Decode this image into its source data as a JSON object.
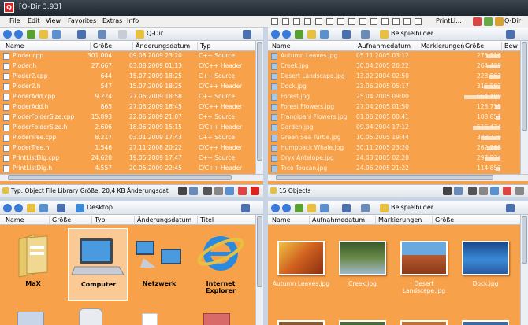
{
  "window": {
    "title": "[Q-Dir 3.93]",
    "app_icon": "Q"
  },
  "menu": [
    "File",
    "Edit",
    "View",
    "Favorites",
    "Extras",
    "Info"
  ],
  "top_right_toolbar": {
    "print_label": "PrintLi...",
    "app_label": "Q-Dir"
  },
  "pane_tl": {
    "path": "Q-Dir",
    "columns": [
      "Name",
      "Größe",
      "Änderungsdatum",
      "Typ"
    ],
    "rows": [
      [
        "Ploder.cpp",
        "301.004",
        "09.08.2009 23:20",
        "C++ Source"
      ],
      [
        "Ploder.h",
        "27.667",
        "03.08.2009 01:13",
        "C/C++ Header"
      ],
      [
        "Ploder2.cpp",
        "644",
        "15.07.2009 18:25",
        "C++ Source"
      ],
      [
        "Ploder2.h",
        "547",
        "15.07.2009 18:25",
        "C/C++ Header"
      ],
      [
        "PloderAdd.cpp",
        "9.224",
        "27.06.2009 18:58",
        "C++ Source"
      ],
      [
        "PloderAdd.h",
        "865",
        "27.06.2009 18:45",
        "C/C++ Header"
      ],
      [
        "PloderFolderSize.cpp",
        "15.893",
        "22.06.2009 21:07",
        "C++ Source"
      ],
      [
        "PloderFolderSize.h",
        "2.606",
        "18.06.2009 15:15",
        "C/C++ Header"
      ],
      [
        "PloderTree.cpp",
        "8.217",
        "03.01.2009 17:43",
        "C++ Source"
      ],
      [
        "PloderTree.h",
        "1.546",
        "27.11.2008 20:22",
        "C/C++ Header"
      ],
      [
        "PrintListDlg.cpp",
        "24.620",
        "19.05.2009 17:47",
        "C++ Source"
      ],
      [
        "PrintListDlg.h",
        "4.557",
        "20.05.2009 22:45",
        "C/C++ Header"
      ]
    ],
    "status": "Typ: Object File Library Größe: 20,4 KB Änderungsdat"
  },
  "pane_tr": {
    "path": "Beispielbilder",
    "columns": [
      "Name",
      "Aufnahmedatum",
      "Markierungen",
      "Größe",
      "Bew"
    ],
    "rows": [
      [
        "Autumn Leaves.jpg",
        "05.11.2005 03:12",
        "",
        "276.216"
      ],
      [
        "Creek.jpg",
        "30.04.2005 20:22",
        "",
        "264.409"
      ],
      [
        "Desert Landscape.jpg",
        "13.02.2004 02:50",
        "",
        "228.863"
      ],
      [
        "Dock.jpg",
        "23.06.2005 05:17",
        "",
        "316.892"
      ],
      [
        "Forest.jpg",
        "25.04.2005 09:00",
        "",
        "664.489"
      ],
      [
        "Forest Flowers.jpg",
        "27.04.2005 01:50",
        "",
        "128.755"
      ],
      [
        "Frangipani Flowers.jpg",
        "01.06.2005 00:41",
        "",
        "108.851"
      ],
      [
        "Garden.jpg",
        "09.04.2004 17:12",
        "",
        "516.424"
      ],
      [
        "Green Sea Turtle.jpg",
        "10.05.2005 19:44",
        "",
        "378.729"
      ],
      [
        "Humpback Whale.jpg",
        "30.11.2005 23:20",
        "",
        "262.268"
      ],
      [
        "Oryx Antelope.jpg",
        "24.03.2005 02:20",
        "",
        "297.834"
      ],
      [
        "Toco Toucan.jpg",
        "24.06.2005 21:22",
        "",
        "114.857"
      ]
    ],
    "size_fraction": [
      0.42,
      0.4,
      0.34,
      0.48,
      1.0,
      0.19,
      0.16,
      0.78,
      0.57,
      0.39,
      0.45,
      0.17
    ],
    "status": "15 Objects"
  },
  "pane_bl": {
    "path": "Desktop",
    "columns": [
      "Name",
      "Größe",
      "Typ",
      "Änderungsdatum",
      "Titel"
    ],
    "items": [
      "MaX",
      "Computer",
      "Netzwerk",
      "Internet Explorer"
    ]
  },
  "pane_br": {
    "path": "Beispielbilder",
    "columns": [
      "Name",
      "Aufnahmedatum",
      "Markierungen",
      "Größe"
    ],
    "items": [
      "Autumn Leaves.jpg",
      "Creek.jpg",
      "Desert Landscape.jpg",
      "Dock.jpg"
    ]
  },
  "colors": {
    "accent": "#f7a24b",
    "selection": "#f08a1c",
    "title_bg": "#2a323a"
  }
}
